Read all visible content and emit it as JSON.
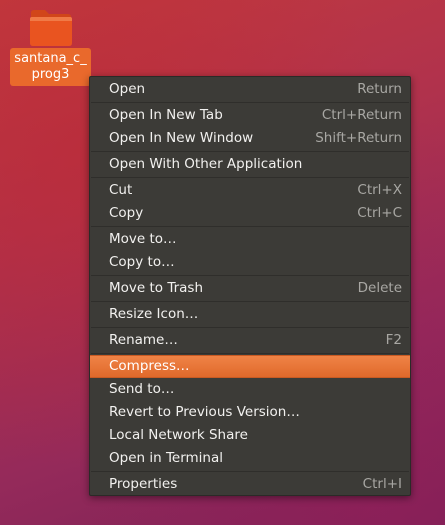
{
  "desktop": {
    "folder_label_line1": "santana_c_",
    "folder_label_line2": "prog3"
  },
  "menu": {
    "items": [
      {
        "label": "Open",
        "shortcut": "Return"
      },
      {
        "label": "Open In New Tab",
        "shortcut": "Ctrl+Return"
      },
      {
        "label": "Open In New Window",
        "shortcut": "Shift+Return"
      },
      {
        "label": "Open With Other Application",
        "shortcut": ""
      },
      {
        "label": "Cut",
        "shortcut": "Ctrl+X"
      },
      {
        "label": "Copy",
        "shortcut": "Ctrl+C"
      },
      {
        "label": "Move to…",
        "shortcut": ""
      },
      {
        "label": "Copy to…",
        "shortcut": ""
      },
      {
        "label": "Move to Trash",
        "shortcut": "Delete"
      },
      {
        "label": "Resize Icon…",
        "shortcut": ""
      },
      {
        "label": "Rename…",
        "shortcut": "F2"
      },
      {
        "label": "Compress…",
        "shortcut": ""
      },
      {
        "label": "Send to…",
        "shortcut": ""
      },
      {
        "label": "Revert to Previous Version…",
        "shortcut": ""
      },
      {
        "label": "Local Network Share",
        "shortcut": ""
      },
      {
        "label": "Open in Terminal",
        "shortcut": ""
      },
      {
        "label": "Properties",
        "shortcut": "Ctrl+I"
      }
    ]
  },
  "colors": {
    "highlight": "#e8793c",
    "menu_background": "#3c3b37",
    "icon_label_background": "#e9692c",
    "folder": "#e95420"
  },
  "icons": {
    "folder": "folder-icon"
  }
}
